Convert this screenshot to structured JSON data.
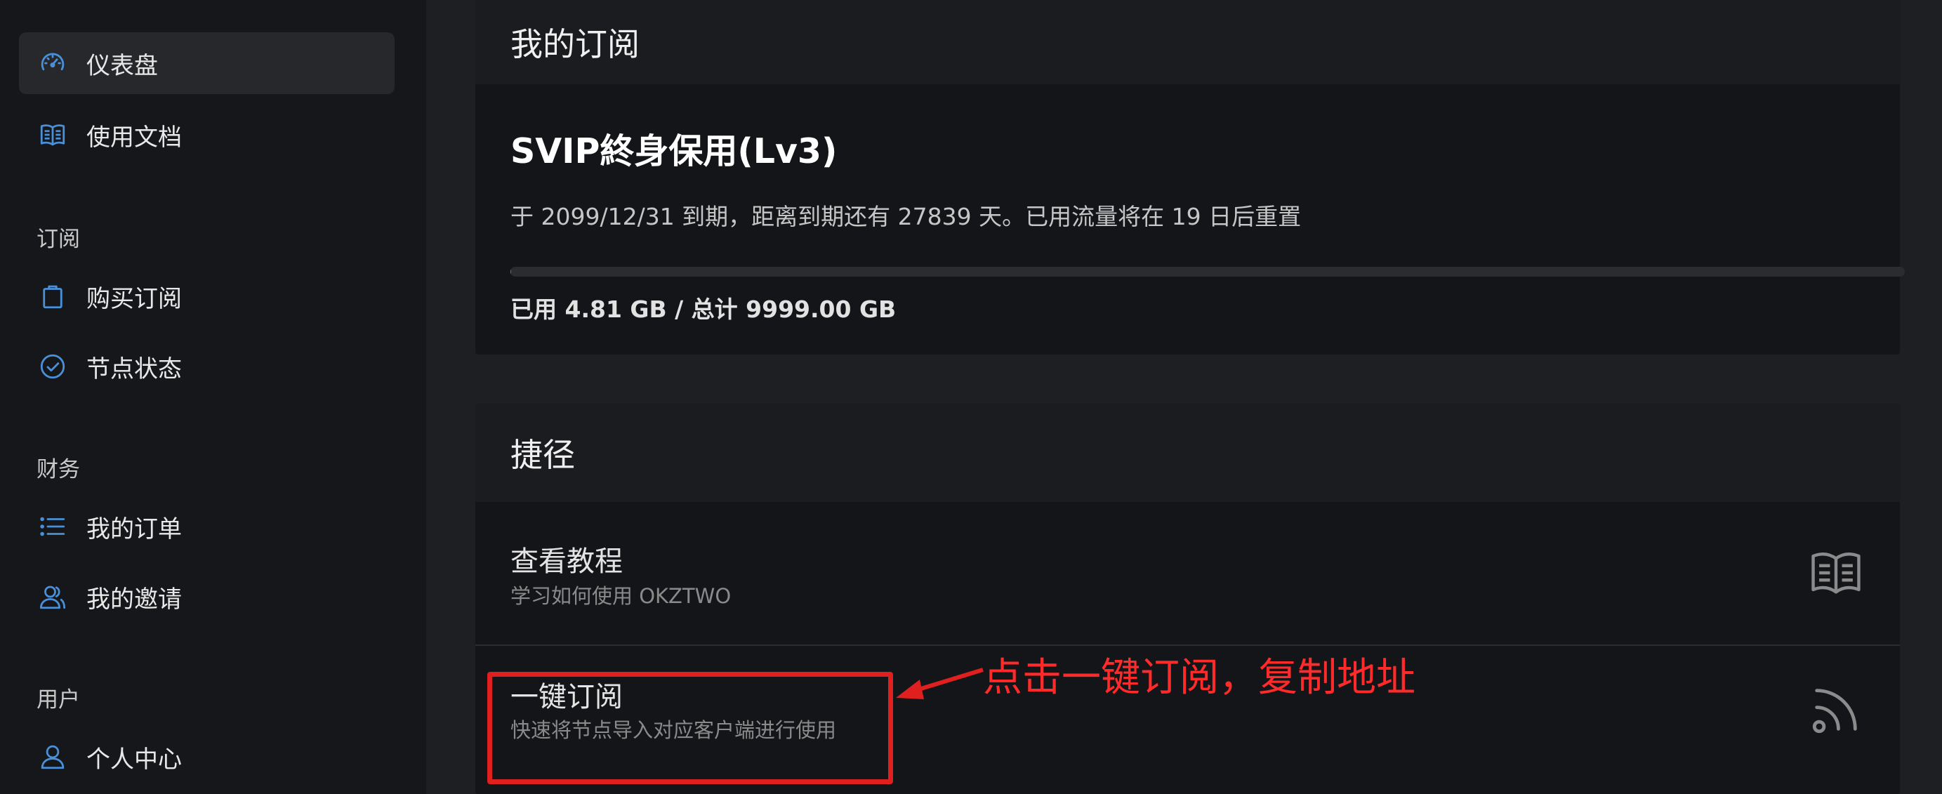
{
  "sidebar": {
    "top_items": [
      {
        "label": "仪表盘",
        "icon": "dashboard-icon",
        "active": true
      },
      {
        "label": "使用文档",
        "icon": "book-icon",
        "active": false
      }
    ],
    "sections": [
      {
        "title": "订阅",
        "items": [
          {
            "label": "购买订阅",
            "icon": "shopping-bag-icon"
          },
          {
            "label": "节点状态",
            "icon": "check-circle-icon"
          }
        ]
      },
      {
        "title": "财务",
        "items": [
          {
            "label": "我的订单",
            "icon": "list-icon"
          },
          {
            "label": "我的邀请",
            "icon": "users-icon"
          }
        ]
      },
      {
        "title": "用户",
        "items": [
          {
            "label": "个人中心",
            "icon": "user-icon"
          }
        ]
      }
    ]
  },
  "subscription": {
    "heading": "我的订阅",
    "plan_name": "SVIP終身保用(Lv3)",
    "expiry_text": "于 2099/12/31 到期，距离到期还有 27839 天。已用流量将在 19 日后重置",
    "usage_text": "已用 4.81 GB / 总计 9999.00 GB",
    "usage_fraction": 0.00048
  },
  "shortcuts": {
    "heading": "捷径",
    "items": [
      {
        "title": "查看教程",
        "subtitle": "学习如何使用 OKZTWO",
        "icon": "book-icon"
      },
      {
        "title": "一键订阅",
        "subtitle": "快速将节点导入对应客户端进行使用",
        "icon": "rss-icon"
      }
    ]
  },
  "annotation": {
    "text": "点击一键订阅，复制地址",
    "color": "#ff2b2b"
  },
  "colors": {
    "accent": "#3a7bd5",
    "icon_blue": "#4a90d9",
    "annotation_red": "#e01f1f"
  }
}
